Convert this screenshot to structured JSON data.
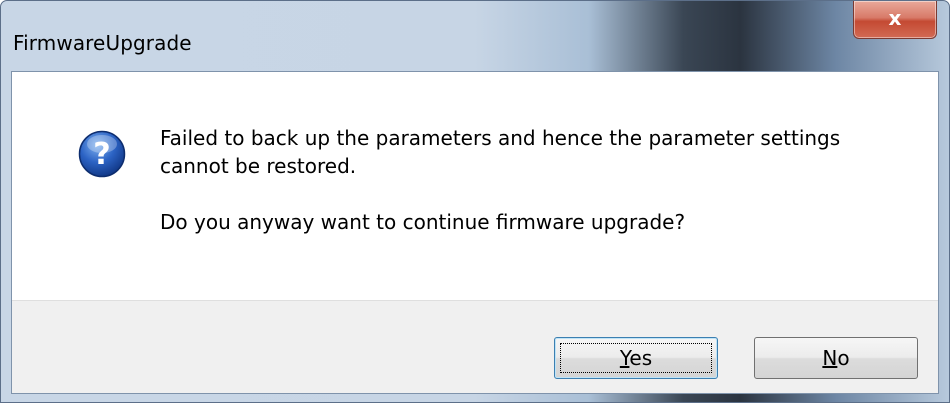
{
  "window": {
    "title": "FirmwareUpgrade",
    "close_glyph": "x"
  },
  "icon": "question-icon",
  "message": {
    "line1": "Failed to back up the parameters and hence the parameter settings",
    "line2": "cannot be restored.",
    "question": "Do you anyway want to continue firmware upgrade?"
  },
  "buttons": {
    "yes": {
      "mnemonic": "Y",
      "rest": "es"
    },
    "no": {
      "mnemonic": "N",
      "rest": "o"
    }
  }
}
